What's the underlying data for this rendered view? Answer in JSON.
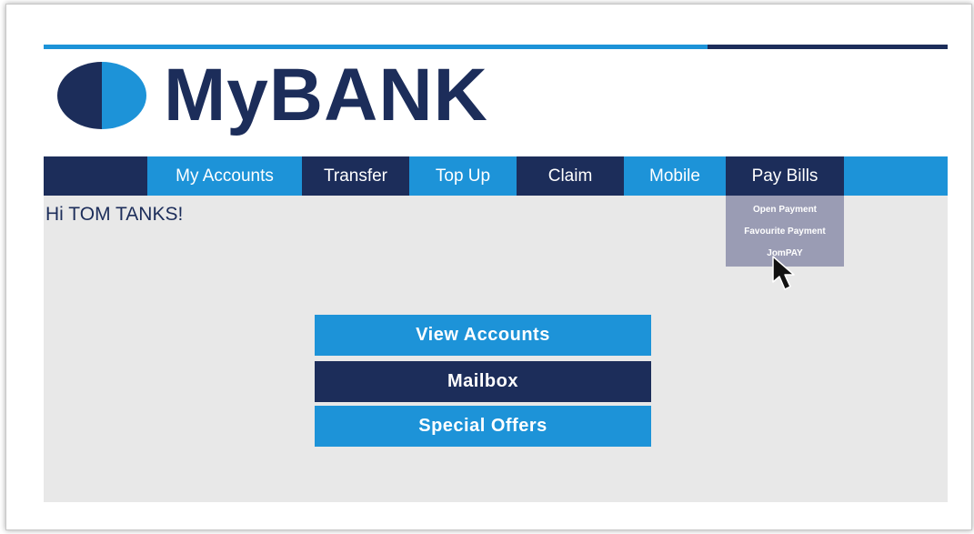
{
  "brand": {
    "name": "MyBANK",
    "logo_icon": "half-circle-logo-icon"
  },
  "colors": {
    "navy": "#1c2d5a",
    "blue": "#1d93d8",
    "panel_bg": "#e8e8e8",
    "dropdown_bg": "#9a9cb4"
  },
  "nav": {
    "items": [
      {
        "label": "My Accounts"
      },
      {
        "label": "Transfer"
      },
      {
        "label": "Top Up"
      },
      {
        "label": "Claim"
      },
      {
        "label": "Mobile"
      },
      {
        "label": "Pay Bills"
      }
    ]
  },
  "pay_bills_menu": {
    "items": [
      {
        "label": "Open Payment"
      },
      {
        "label": "Favourite Payment"
      },
      {
        "label": "JomPAY"
      }
    ]
  },
  "greeting": "Hi TOM TANKS!",
  "actions": {
    "view_accounts": "View Accounts",
    "mailbox": "Mailbox",
    "special_offers": "Special Offers"
  },
  "cursor_icon": "mouse-pointer-icon"
}
